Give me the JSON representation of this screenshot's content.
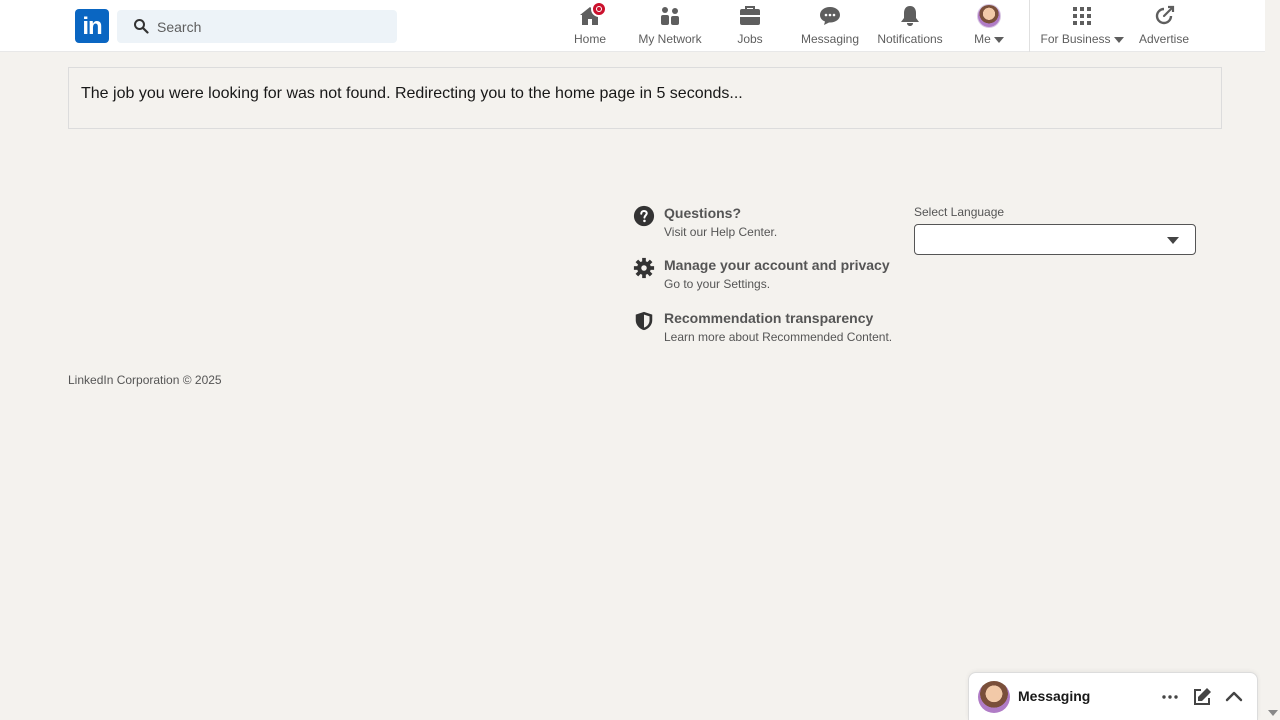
{
  "app": {
    "brand": "in",
    "brand_color": "#0a66c2"
  },
  "search": {
    "placeholder": "Search"
  },
  "nav": {
    "home": "Home",
    "network": "My Network",
    "jobs": "Jobs",
    "messaging": "Messaging",
    "notifications": "Notifications",
    "me": "Me",
    "business": "For Business",
    "advertise": "Advertise"
  },
  "notice": {
    "text": "The job you were looking for was not found. Redirecting you to the home page in 5 seconds..."
  },
  "footer": {
    "links": [
      {
        "title": "Questions?",
        "subtitle": "Visit our Help Center.",
        "icon": "question-icon"
      },
      {
        "title": "Manage your account and privacy",
        "subtitle": "Go to your Settings.",
        "icon": "gear-icon"
      },
      {
        "title": "Recommendation transparency",
        "subtitle": "Learn more about Recommended Content.",
        "icon": "shield-icon"
      }
    ],
    "language_label": "Select Language",
    "language_value": "",
    "copyright": "LinkedIn Corporation © 2025"
  },
  "messaging_dock": {
    "label": "Messaging"
  },
  "colors": {
    "badge": "#cb112d",
    "background": "#f4f2ee"
  }
}
